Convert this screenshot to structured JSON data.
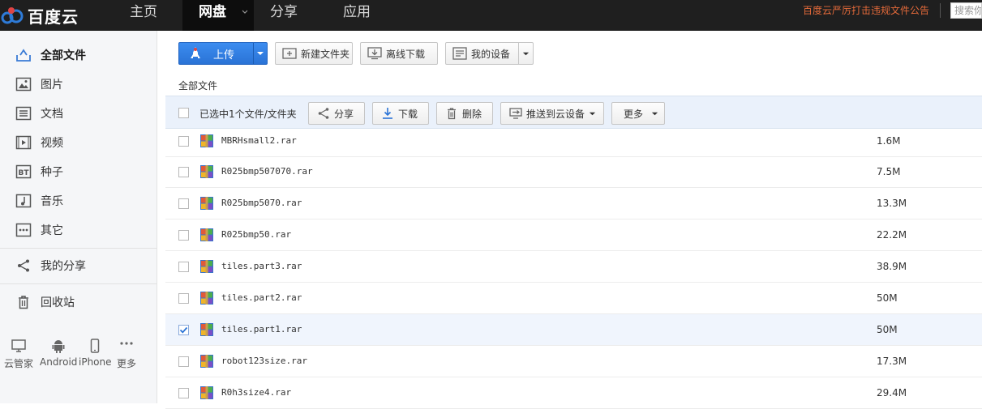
{
  "header": {
    "logo_text": "百度云",
    "nav": [
      {
        "label": "主页"
      },
      {
        "label": "网盘",
        "active": true
      },
      {
        "label": "分享"
      },
      {
        "label": "应用"
      }
    ],
    "notice": "百度云严厉打击违规文件公告",
    "search_placeholder": "搜索你"
  },
  "sidebar": {
    "items": [
      {
        "label": "全部文件",
        "icon": "folder-icon",
        "active": true
      },
      {
        "label": "图片",
        "icon": "image-icon"
      },
      {
        "label": "文档",
        "icon": "document-icon"
      },
      {
        "label": "视频",
        "icon": "video-icon"
      },
      {
        "label": "种子",
        "icon": "bt-icon"
      },
      {
        "label": "音乐",
        "icon": "music-icon"
      },
      {
        "label": "其它",
        "icon": "more-icon"
      },
      {
        "label": "我的分享",
        "icon": "share-icon"
      },
      {
        "label": "回收站",
        "icon": "trash-icon"
      }
    ],
    "devices": [
      {
        "label": "云管家",
        "icon": "monitor-icon"
      },
      {
        "label": "Android",
        "icon": "android-icon"
      },
      {
        "label": "iPhone",
        "icon": "phone-icon"
      },
      {
        "label": "更多",
        "icon": "ellipsis-icon"
      }
    ]
  },
  "toolbar": {
    "upload": "上传",
    "new_folder": "新建文件夹",
    "offline_download": "离线下载",
    "my_devices": "我的设备"
  },
  "breadcrumb": "全部文件",
  "selection_bar": {
    "selected_text": "已选中1个文件/文件夹",
    "share": "分享",
    "download": "下载",
    "delete": "删除",
    "push": "推送到云设备",
    "more": "更多"
  },
  "files": [
    {
      "name": "MBRHsmall2.rar",
      "size": "1.6M",
      "checked": false
    },
    {
      "name": "R025bmp507070.rar",
      "size": "7.5M",
      "checked": false
    },
    {
      "name": "R025bmp5070.rar",
      "size": "13.3M",
      "checked": false
    },
    {
      "name": "R025bmp50.rar",
      "size": "22.2M",
      "checked": false
    },
    {
      "name": "tiles.part3.rar",
      "size": "38.9M",
      "checked": false
    },
    {
      "name": "tiles.part2.rar",
      "size": "50M",
      "checked": false
    },
    {
      "name": "tiles.part1.rar",
      "size": "50M",
      "checked": true
    },
    {
      "name": "robot123size.rar",
      "size": "17.3M",
      "checked": false
    },
    {
      "name": "R0h3size4.rar",
      "size": "29.4M",
      "checked": false
    }
  ],
  "colors": {
    "topbar": "#1f1f1f",
    "accent_blue": "#2a73d6",
    "notice": "#e46a3a",
    "selection_bg": "#eaf1fb"
  }
}
